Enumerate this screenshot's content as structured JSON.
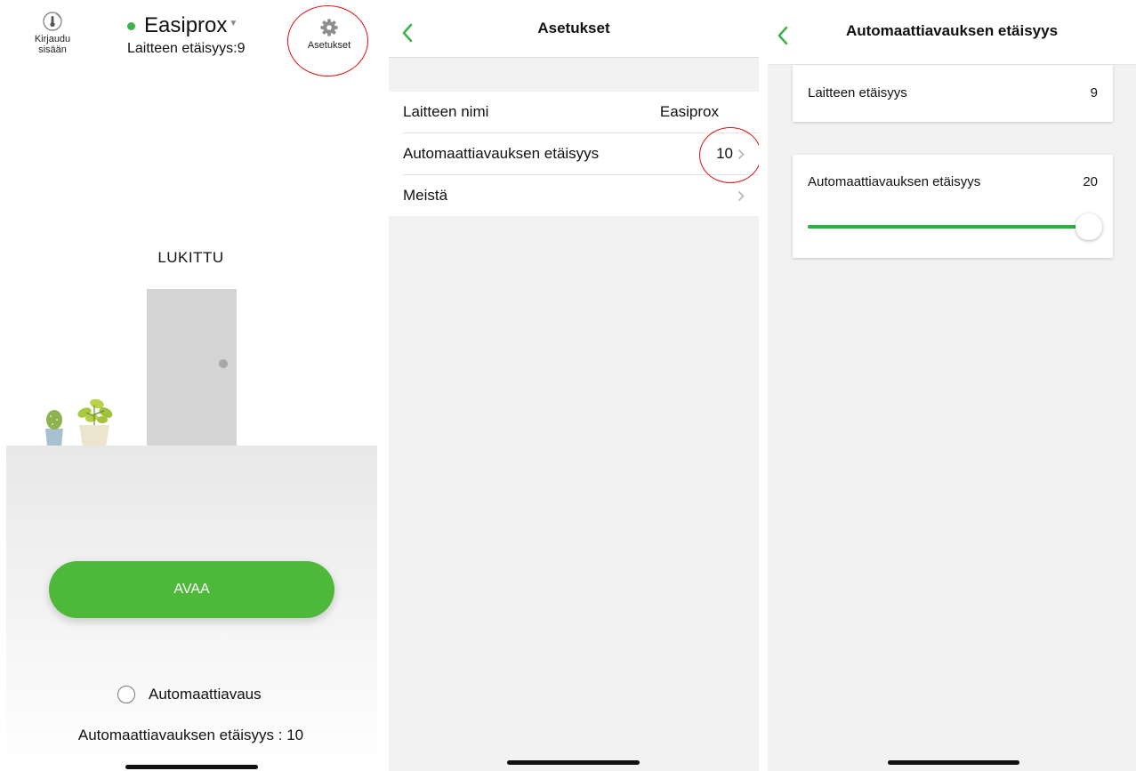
{
  "screen1": {
    "login": {
      "label": "Kirjaudu\nsisään",
      "icon": "thermometer-icon"
    },
    "device": {
      "name": "Easiprox",
      "status_color": "#3cb44a",
      "distance": "Laitteen etäisyys:9"
    },
    "settings": {
      "label": "Asetukset",
      "icon": "gear-icon"
    },
    "lock_status": "LUKITTU",
    "open_button": "AVAA",
    "auto_open": {
      "label": "Automaattiavaus",
      "checked": false
    },
    "auto_distance": "Automaattiavauksen etäisyys : 10"
  },
  "screen2": {
    "title": "Asetukset",
    "items": [
      {
        "label": "Laitteen nimi",
        "value": "Easiprox"
      },
      {
        "label": "Automaattiavauksen etäisyys",
        "value": "10"
      },
      {
        "label": "Meistä",
        "value": ""
      }
    ]
  },
  "screen3": {
    "title": "Automaattiavauksen etäisyys",
    "device_distance": {
      "label": "Laitteen etäisyys",
      "value": "9"
    },
    "auto_distance": {
      "label": "Automaattiavauksen etäisyys",
      "value": "20",
      "slider_fraction": 1.0
    }
  },
  "colors": {
    "accent": "#4db83a",
    "slider": "#29b33b",
    "annotation": "#dd1111"
  }
}
